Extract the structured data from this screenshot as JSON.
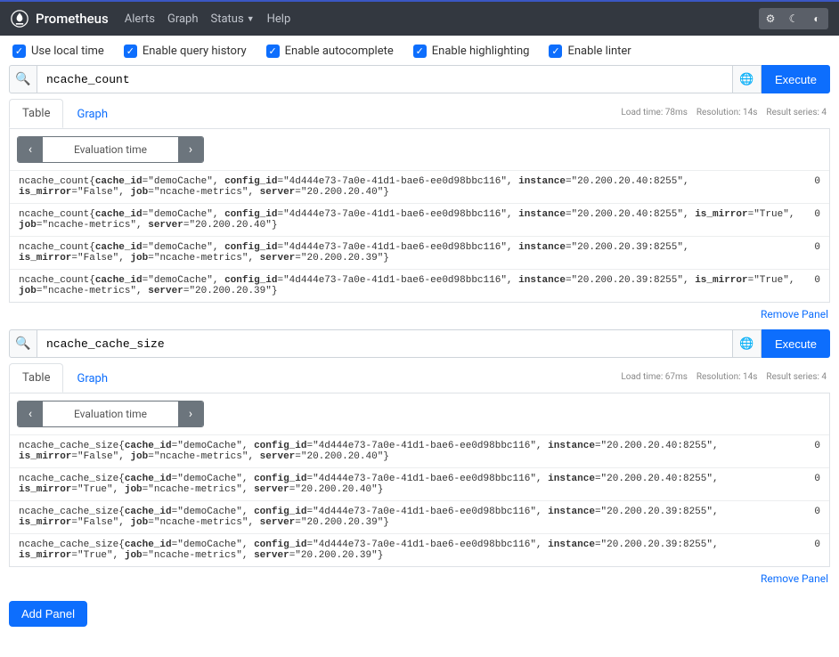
{
  "brand": "Prometheus",
  "nav": {
    "alerts": "Alerts",
    "graph": "Graph",
    "status": "Status",
    "help": "Help"
  },
  "options": {
    "local_time": "Use local time",
    "query_history": "Enable query history",
    "autocomplete": "Enable autocomplete",
    "highlighting": "Enable highlighting",
    "linter": "Enable linter"
  },
  "execute": "Execute",
  "tabs": {
    "table": "Table",
    "graph": "Graph"
  },
  "eval_label": "Evaluation time",
  "remove": "Remove Panel",
  "add": "Add Panel",
  "panels": [
    {
      "expr": "ncache_count",
      "stats": {
        "load": "Load time: 78ms",
        "res": "Resolution: 14s",
        "series": "Result series: 4"
      },
      "rows": [
        {
          "metric": "ncache_count{<b>cache_id</b>=\"demoCache\", <b>config_id</b>=\"4d444e73-7a0e-41d1-bae6-ee0d98bbc116\", <b>instance</b>=\"20.200.20.40:8255\", <b>is_mirror</b>=\"False\", <b>job</b>=\"ncache-metrics\", <b>server</b>=\"20.200.20.40\"}",
          "value": "0"
        },
        {
          "metric": "ncache_count{<b>cache_id</b>=\"demoCache\", <b>config_id</b>=\"4d444e73-7a0e-41d1-bae6-ee0d98bbc116\", <b>instance</b>=\"20.200.20.40:8255\", <b>is_mirror</b>=\"True\", <b>job</b>=\"ncache-metrics\", <b>server</b>=\"20.200.20.40\"}",
          "value": "0"
        },
        {
          "metric": "ncache_count{<b>cache_id</b>=\"demoCache\", <b>config_id</b>=\"4d444e73-7a0e-41d1-bae6-ee0d98bbc116\", <b>instance</b>=\"20.200.20.39:8255\", <b>is_mirror</b>=\"False\", <b>job</b>=\"ncache-metrics\", <b>server</b>=\"20.200.20.39\"}",
          "value": "0"
        },
        {
          "metric": "ncache_count{<b>cache_id</b>=\"demoCache\", <b>config_id</b>=\"4d444e73-7a0e-41d1-bae6-ee0d98bbc116\", <b>instance</b>=\"20.200.20.39:8255\", <b>is_mirror</b>=\"True\", <b>job</b>=\"ncache-metrics\", <b>server</b>=\"20.200.20.39\"}",
          "value": "0"
        }
      ]
    },
    {
      "expr": "ncache_cache_size",
      "stats": {
        "load": "Load time: 67ms",
        "res": "Resolution: 14s",
        "series": "Result series: 4"
      },
      "rows": [
        {
          "metric": "ncache_cache_size{<b>cache_id</b>=\"demoCache\", <b>config_id</b>=\"4d444e73-7a0e-41d1-bae6-ee0d98bbc116\", <b>instance</b>=\"20.200.20.40:8255\", <b>is_mirror</b>=\"False\", <b>job</b>=\"ncache-metrics\", <b>server</b>=\"20.200.20.40\"}",
          "value": "0"
        },
        {
          "metric": "ncache_cache_size{<b>cache_id</b>=\"demoCache\", <b>config_id</b>=\"4d444e73-7a0e-41d1-bae6-ee0d98bbc116\", <b>instance</b>=\"20.200.20.40:8255\", <b>is_mirror</b>=\"True\", <b>job</b>=\"ncache-metrics\", <b>server</b>=\"20.200.20.40\"}",
          "value": "0"
        },
        {
          "metric": "ncache_cache_size{<b>cache_id</b>=\"demoCache\", <b>config_id</b>=\"4d444e73-7a0e-41d1-bae6-ee0d98bbc116\", <b>instance</b>=\"20.200.20.39:8255\", <b>is_mirror</b>=\"False\", <b>job</b>=\"ncache-metrics\", <b>server</b>=\"20.200.20.39\"}",
          "value": "0"
        },
        {
          "metric": "ncache_cache_size{<b>cache_id</b>=\"demoCache\", <b>config_id</b>=\"4d444e73-7a0e-41d1-bae6-ee0d98bbc116\", <b>instance</b>=\"20.200.20.39:8255\", <b>is_mirror</b>=\"True\", <b>job</b>=\"ncache-metrics\", <b>server</b>=\"20.200.20.39\"}",
          "value": "0"
        }
      ]
    }
  ]
}
